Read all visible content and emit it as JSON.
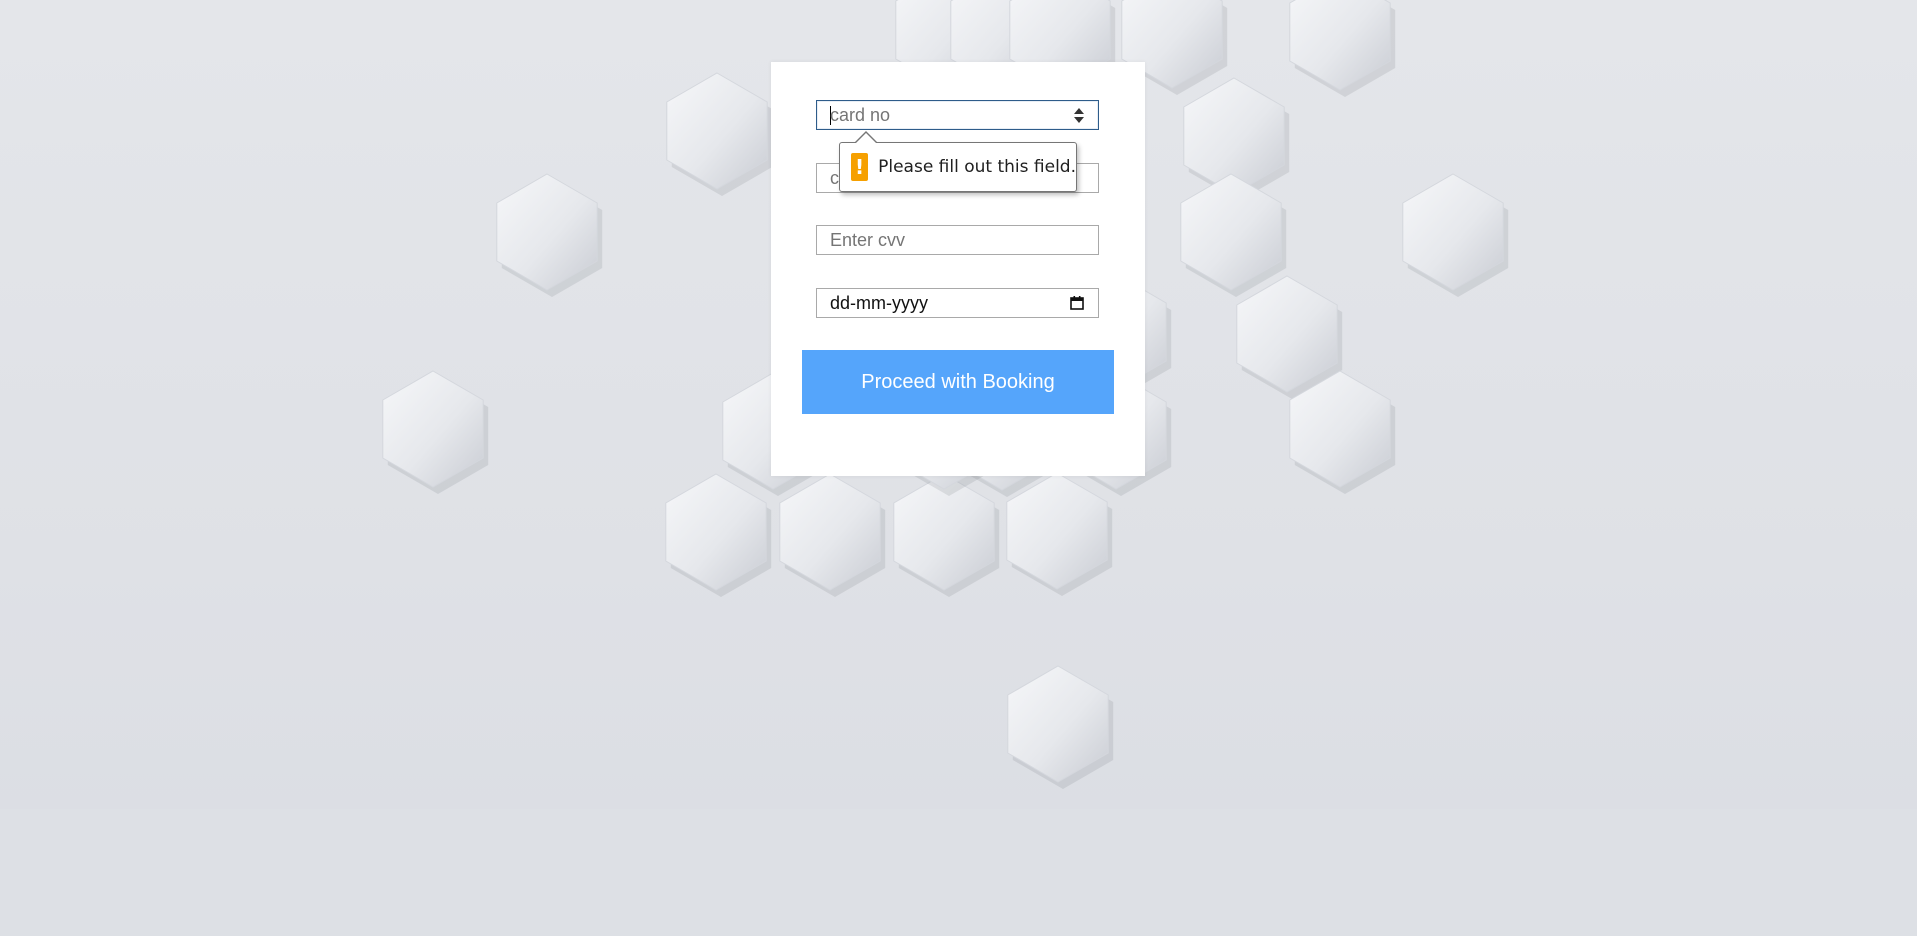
{
  "form": {
    "card_no": {
      "value": "",
      "placeholder": "card no"
    },
    "card_holder": {
      "value": "",
      "placeholder": "c"
    },
    "cvv": {
      "value": "",
      "placeholder": "Enter cvv"
    },
    "date": {
      "value": "dd-mm-yyyy"
    },
    "submit_label": "Proceed with Booking"
  },
  "validation": {
    "message": "Please fill out this field.",
    "icon": "warning-icon",
    "icon_glyph": "!",
    "icon_color": "#f6a000"
  },
  "colors": {
    "accent": "#55a5fb",
    "background": "#e1e3e8",
    "card": "#ffffff"
  },
  "icons": {
    "date_picker": "calendar-icon",
    "number_spinner": "spinner-icon"
  }
}
